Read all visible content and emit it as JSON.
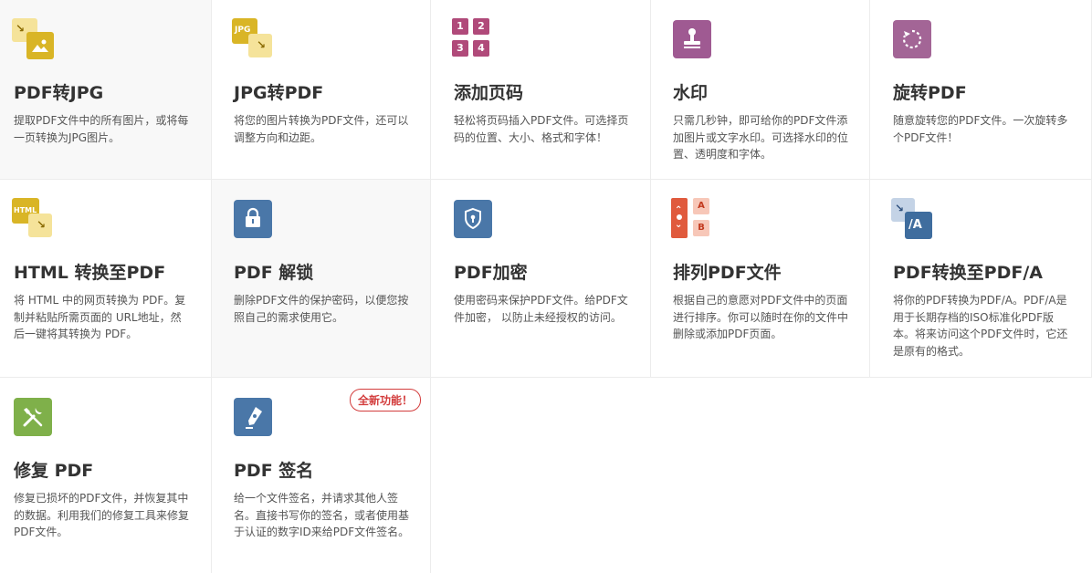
{
  "tools": [
    {
      "title": "PDF转JPG",
      "desc": "提取PDF文件中的所有图片，或将每一页转换为JPG图片。",
      "icon": "pdf-to-jpg-icon"
    },
    {
      "title": "JPG转PDF",
      "desc": "将您的图片转换为PDF文件，还可以调整方向和边距。",
      "icon": "jpg-to-pdf-icon",
      "icon_text": "JPG"
    },
    {
      "title": "添加页码",
      "desc": "轻松将页码插入PDF文件。可选择页码的位置、大小、格式和字体！",
      "icon": "page-numbers-icon",
      "icon_digits": [
        "1",
        "2",
        "3",
        "4"
      ]
    },
    {
      "title": "水印",
      "desc": "只需几秒钟，即可给你的PDF文件添加图片或文字水印。可选择水印的位置、透明度和字体。",
      "icon": "stamp-icon"
    },
    {
      "title": "旋转PDF",
      "desc": "随意旋转您的PDF文件。一次旋转多个PDF文件！",
      "icon": "rotate-icon"
    },
    {
      "title": "HTML 转换至PDF",
      "desc": "将 HTML 中的网页转换为 PDF。复制并粘贴所需页面的 URL地址，然后一键将其转换为 PDF。",
      "icon": "html-to-pdf-icon",
      "icon_text": "HTML"
    },
    {
      "title": "PDF 解锁",
      "desc": "删除PDF文件的保护密码，以便您按照自己的需求使用它。",
      "icon": "unlock-icon"
    },
    {
      "title": "PDF加密",
      "desc": "使用密码来保护PDF文件。给PDF文件加密， 以防止未经授权的访问。",
      "icon": "shield-icon"
    },
    {
      "title": "排列PDF文件",
      "desc": "根据自己的意愿对PDF文件中的页面进行排序。你可以随时在你的文件中删除或添加PDF页面。",
      "icon": "organize-pages-icon",
      "icon_letters": [
        "A",
        "B"
      ]
    },
    {
      "title": "PDF转换至PDF/A",
      "desc": "将你的PDF转换为PDF/A。PDF/A是用于长期存档的ISO标准化PDF版本。将来访问这个PDF文件时，它还是原有的格式。",
      "icon": "pdf-to-pdfa-icon",
      "icon_text": "/A"
    },
    {
      "title": "修复 PDF",
      "desc": "修复已损坏的PDF文件，并恢复其中的数据。利用我们的修复工具来修复PDF文件。",
      "icon": "repair-tools-icon"
    },
    {
      "title": "PDF 签名",
      "desc": "给一个文件签名，并请求其他人签名。直接书写你的签名，或者使用基于认证的数字ID来给PDF文件签名。",
      "icon": "pen-nib-icon",
      "badge": "全新功能！"
    }
  ]
}
